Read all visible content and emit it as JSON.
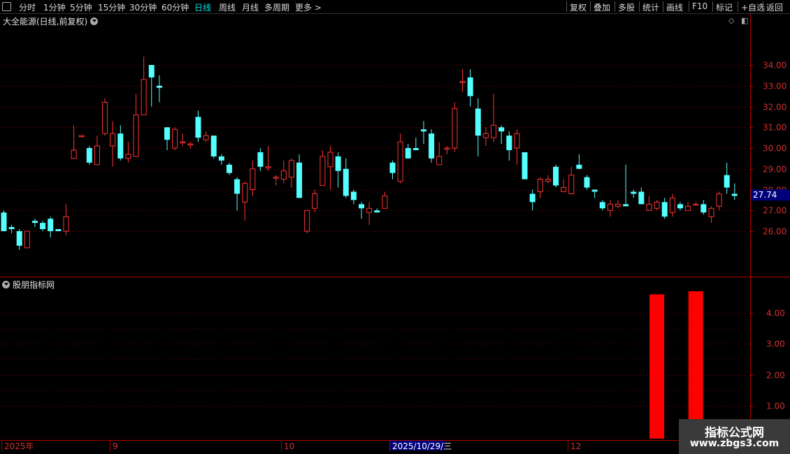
{
  "toolbar": {
    "left_items": [
      {
        "label": "分时",
        "active": false
      },
      {
        "label": "1分钟",
        "active": false
      },
      {
        "label": "5分钟",
        "active": false
      },
      {
        "label": "15分钟",
        "active": false
      },
      {
        "label": "30分钟",
        "active": false
      },
      {
        "label": "60分钟",
        "active": false
      },
      {
        "label": "日线",
        "active": true
      },
      {
        "label": "周线",
        "active": false
      },
      {
        "label": "月线",
        "active": false
      },
      {
        "label": "多周期",
        "active": false
      },
      {
        "label": "更多 >",
        "active": false
      }
    ],
    "right_items": [
      "复权",
      "叠加",
      "多股",
      "统计",
      "画线",
      "F10",
      "标记",
      "+自选",
      "返回"
    ]
  },
  "stock": {
    "title": "大全能源(日线,前复权)"
  },
  "indicator": {
    "title": "股朋指标网"
  },
  "colors": {
    "up": "#ff3232",
    "down": "#54ffff",
    "grid": "#800000",
    "axis": "#b00000",
    "price_tag_bg": "#00007a",
    "bar": "#ff0000"
  },
  "chart_data": [
    {
      "type": "candlestick",
      "price_axis": {
        "ticks": [
          "34.00",
          "33.00",
          "32.00",
          "31.00",
          "30.00",
          "29.00",
          "28.00",
          "27.00",
          "26.00"
        ],
        "range": [
          25.0,
          35.0
        ]
      },
      "current_price_label": "27.74",
      "time_axis": [
        {
          "label": "2025年",
          "highlight": false
        },
        {
          "label": "9",
          "highlight": false
        },
        {
          "label": "10",
          "highlight": false
        },
        {
          "label": "2025/10/29/三",
          "highlight": true
        },
        {
          "label": "12",
          "highlight": false
        }
      ],
      "candles": [
        [
          26.9,
          26.0,
          27.0,
          26.0
        ],
        [
          26.2,
          26.1,
          26.3,
          25.9
        ],
        [
          26.0,
          25.3,
          26.1,
          25.1
        ],
        [
          25.2,
          26.0,
          26.0,
          25.2
        ],
        [
          26.5,
          26.4,
          26.6,
          26.2
        ],
        [
          26.4,
          26.1,
          26.5,
          26.0
        ],
        [
          26.6,
          26.0,
          26.7,
          25.7
        ],
        [
          26.1,
          26.0,
          26.1,
          26.0
        ],
        [
          26.0,
          26.7,
          27.3,
          25.8
        ],
        [
          29.5,
          29.9,
          31.1,
          29.5
        ],
        [
          30.6,
          30.6,
          30.6,
          30.5
        ],
        [
          30.0,
          29.3,
          30.1,
          29.2
        ],
        [
          29.2,
          30.1,
          30.6,
          29.2
        ],
        [
          30.7,
          32.2,
          32.4,
          30.6
        ],
        [
          30.1,
          30.7,
          31.3,
          29.1
        ],
        [
          30.7,
          29.5,
          31.1,
          29.4
        ],
        [
          29.5,
          29.7,
          30.3,
          29.3
        ],
        [
          29.6,
          31.6,
          32.6,
          29.8
        ],
        [
          31.6,
          33.3,
          34.4,
          31.9
        ],
        [
          34.0,
          33.4,
          33.9,
          32.0
        ],
        [
          33.0,
          32.9,
          33.5,
          32.2
        ],
        [
          31.0,
          30.4,
          31.0,
          29.9
        ],
        [
          30.0,
          30.9,
          31.0,
          29.9
        ],
        [
          30.3,
          30.3,
          30.7,
          30.1
        ],
        [
          30.2,
          30.2,
          30.3,
          30.0
        ],
        [
          31.5,
          30.5,
          31.8,
          30.3
        ],
        [
          30.4,
          30.6,
          30.8,
          30.3
        ],
        [
          30.6,
          29.6,
          30.6,
          29.5
        ],
        [
          29.6,
          29.4,
          29.7,
          29.2
        ],
        [
          29.2,
          28.8,
          29.3,
          28.7
        ],
        [
          28.5,
          27.8,
          28.6,
          27.0
        ],
        [
          27.4,
          28.3,
          28.4,
          26.5
        ],
        [
          28.0,
          29.0,
          29.4,
          27.7
        ],
        [
          29.8,
          29.1,
          30.0,
          28.9
        ],
        [
          29.1,
          29.1,
          30.1,
          28.9
        ],
        [
          28.6,
          28.6,
          28.7,
          28.2
        ],
        [
          28.5,
          28.9,
          29.4,
          28.3
        ],
        [
          28.6,
          29.4,
          29.5,
          28.1
        ],
        [
          29.3,
          27.6,
          29.7,
          27.6
        ],
        [
          26.0,
          27.0,
          27.0,
          25.9
        ],
        [
          27.1,
          27.8,
          28.0,
          26.9
        ],
        [
          28.2,
          29.6,
          29.9,
          28.2
        ],
        [
          29.1,
          29.8,
          30.1,
          28.0
        ],
        [
          29.6,
          28.9,
          29.8,
          28.1
        ],
        [
          29.0,
          27.7,
          29.5,
          27.6
        ],
        [
          27.9,
          27.5,
          28.0,
          27.3
        ],
        [
          27.3,
          27.1,
          27.4,
          26.6
        ],
        [
          26.9,
          27.1,
          27.4,
          26.3
        ],
        [
          27.0,
          26.9,
          27.1,
          26.9
        ],
        [
          27.1,
          27.7,
          27.9,
          27.1
        ],
        [
          29.3,
          28.8,
          29.4,
          28.5
        ],
        [
          28.4,
          30.3,
          30.7,
          28.3
        ],
        [
          30.0,
          29.5,
          30.2,
          29.5
        ],
        [
          30.0,
          29.9,
          30.5,
          29.9
        ],
        [
          30.9,
          30.8,
          31.3,
          30.2
        ],
        [
          30.7,
          29.5,
          30.9,
          29.3
        ],
        [
          29.2,
          29.6,
          30.3,
          29.3
        ],
        [
          30.0,
          30.0,
          30.1,
          29.7
        ],
        [
          30.0,
          31.9,
          32.2,
          29.8
        ],
        [
          33.2,
          33.2,
          33.8,
          32.7
        ],
        [
          33.4,
          32.5,
          33.8,
          32.0
        ],
        [
          31.9,
          30.6,
          32.4,
          29.6
        ],
        [
          30.5,
          30.7,
          31.0,
          30.1
        ],
        [
          30.5,
          31.1,
          32.6,
          30.3
        ],
        [
          31.0,
          30.8,
          31.1,
          30.2
        ],
        [
          30.6,
          29.9,
          30.8,
          29.4
        ],
        [
          30.0,
          30.7,
          30.9,
          29.2
        ],
        [
          29.8,
          28.5,
          29.8,
          28.5
        ],
        [
          27.8,
          27.4,
          28.0,
          27.0
        ],
        [
          27.9,
          28.5,
          28.6,
          27.6
        ],
        [
          28.4,
          28.5,
          28.7,
          28.3
        ],
        [
          29.1,
          28.2,
          29.2,
          28.1
        ],
        [
          27.9,
          28.1,
          28.5,
          27.9
        ],
        [
          27.8,
          28.7,
          29.1,
          27.9
        ],
        [
          29.2,
          29.0,
          29.7,
          29.0
        ],
        [
          28.6,
          28.1,
          28.7,
          28.0
        ],
        [
          28.0,
          27.9,
          28.0,
          27.6
        ],
        [
          27.4,
          27.1,
          27.5,
          27.0
        ],
        [
          27.0,
          27.3,
          27.5,
          26.7
        ],
        [
          27.2,
          27.3,
          27.5,
          27.1
        ],
        [
          27.3,
          27.2,
          29.2,
          27.2
        ],
        [
          27.9,
          27.8,
          28.0,
          27.6
        ],
        [
          27.9,
          27.3,
          28.1,
          27.3
        ],
        [
          27.0,
          27.3,
          27.7,
          27.0
        ],
        [
          27.1,
          27.4,
          27.5,
          27.0
        ],
        [
          27.4,
          26.7,
          27.6,
          26.6
        ],
        [
          26.9,
          27.6,
          27.8,
          26.7
        ],
        [
          27.3,
          27.1,
          27.4,
          27.0
        ],
        [
          27.0,
          27.2,
          27.4,
          27.0
        ],
        [
          27.3,
          27.3,
          27.4,
          27.3
        ],
        [
          27.3,
          26.9,
          27.5,
          26.8
        ],
        [
          26.7,
          27.1,
          27.2,
          26.4
        ],
        [
          27.2,
          27.8,
          27.9,
          27.0
        ],
        [
          28.7,
          28.1,
          29.3,
          27.8
        ],
        [
          27.8,
          27.7,
          28.3,
          27.5
        ]
      ]
    },
    {
      "type": "bar",
      "y_axis": {
        "ticks": [
          "4.00",
          "3.00",
          "2.00",
          "1.00"
        ],
        "range": [
          0.0,
          4.9
        ]
      },
      "bars": [
        {
          "candle_index": 84,
          "value": 4.6
        },
        {
          "candle_index": 89,
          "value": 4.7
        }
      ]
    }
  ],
  "watermark": {
    "line1": "指标公式网",
    "line2": "www.zbgs3.com"
  }
}
